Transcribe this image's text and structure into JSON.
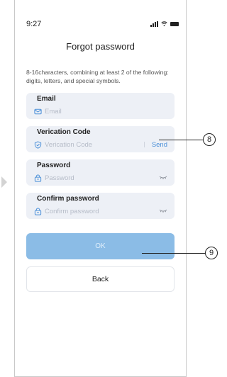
{
  "status_bar": {
    "time": "9:27"
  },
  "title": "Forgot password",
  "hint": "8-16characters, combining at least 2 of the following: digits, letters, and special symbols.",
  "fields": {
    "email": {
      "label": "Email",
      "placeholder": "Email",
      "icon": "mail-icon"
    },
    "code": {
      "label": "Verication Code",
      "placeholder": "Verication Code",
      "icon": "shield-check-icon",
      "send": "Send"
    },
    "password": {
      "label": "Password",
      "placeholder": "Password",
      "icon": "lock-icon"
    },
    "confirm": {
      "label": "Confirm password",
      "placeholder": "Confirm password",
      "icon": "lock-icon"
    }
  },
  "buttons": {
    "ok": "OK",
    "back": "Back"
  },
  "callouts": {
    "send": "8",
    "ok": "9"
  },
  "colors": {
    "accent": "#4a8fd8",
    "ok_button": "#8bbce6",
    "field_bg": "#edf0f6"
  }
}
